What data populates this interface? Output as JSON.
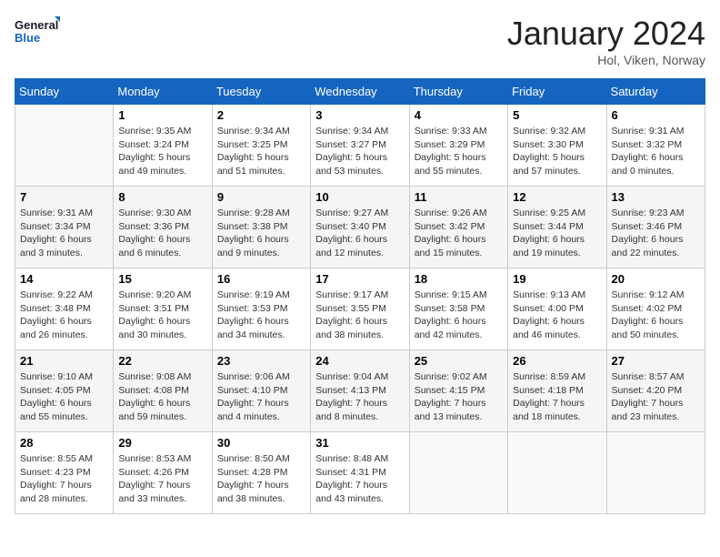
{
  "logo": {
    "line1": "General",
    "line2": "Blue"
  },
  "title": "January 2024",
  "location": "Hol, Viken, Norway",
  "days_of_week": [
    "Sunday",
    "Monday",
    "Tuesday",
    "Wednesday",
    "Thursday",
    "Friday",
    "Saturday"
  ],
  "weeks": [
    [
      {
        "day": "",
        "info": ""
      },
      {
        "day": "1",
        "info": "Sunrise: 9:35 AM\nSunset: 3:24 PM\nDaylight: 5 hours\nand 49 minutes."
      },
      {
        "day": "2",
        "info": "Sunrise: 9:34 AM\nSunset: 3:25 PM\nDaylight: 5 hours\nand 51 minutes."
      },
      {
        "day": "3",
        "info": "Sunrise: 9:34 AM\nSunset: 3:27 PM\nDaylight: 5 hours\nand 53 minutes."
      },
      {
        "day": "4",
        "info": "Sunrise: 9:33 AM\nSunset: 3:29 PM\nDaylight: 5 hours\nand 55 minutes."
      },
      {
        "day": "5",
        "info": "Sunrise: 9:32 AM\nSunset: 3:30 PM\nDaylight: 5 hours\nand 57 minutes."
      },
      {
        "day": "6",
        "info": "Sunrise: 9:31 AM\nSunset: 3:32 PM\nDaylight: 6 hours\nand 0 minutes."
      }
    ],
    [
      {
        "day": "7",
        "info": "Sunrise: 9:31 AM\nSunset: 3:34 PM\nDaylight: 6 hours\nand 3 minutes."
      },
      {
        "day": "8",
        "info": "Sunrise: 9:30 AM\nSunset: 3:36 PM\nDaylight: 6 hours\nand 6 minutes."
      },
      {
        "day": "9",
        "info": "Sunrise: 9:28 AM\nSunset: 3:38 PM\nDaylight: 6 hours\nand 9 minutes."
      },
      {
        "day": "10",
        "info": "Sunrise: 9:27 AM\nSunset: 3:40 PM\nDaylight: 6 hours\nand 12 minutes."
      },
      {
        "day": "11",
        "info": "Sunrise: 9:26 AM\nSunset: 3:42 PM\nDaylight: 6 hours\nand 15 minutes."
      },
      {
        "day": "12",
        "info": "Sunrise: 9:25 AM\nSunset: 3:44 PM\nDaylight: 6 hours\nand 19 minutes."
      },
      {
        "day": "13",
        "info": "Sunrise: 9:23 AM\nSunset: 3:46 PM\nDaylight: 6 hours\nand 22 minutes."
      }
    ],
    [
      {
        "day": "14",
        "info": "Sunrise: 9:22 AM\nSunset: 3:48 PM\nDaylight: 6 hours\nand 26 minutes."
      },
      {
        "day": "15",
        "info": "Sunrise: 9:20 AM\nSunset: 3:51 PM\nDaylight: 6 hours\nand 30 minutes."
      },
      {
        "day": "16",
        "info": "Sunrise: 9:19 AM\nSunset: 3:53 PM\nDaylight: 6 hours\nand 34 minutes."
      },
      {
        "day": "17",
        "info": "Sunrise: 9:17 AM\nSunset: 3:55 PM\nDaylight: 6 hours\nand 38 minutes."
      },
      {
        "day": "18",
        "info": "Sunrise: 9:15 AM\nSunset: 3:58 PM\nDaylight: 6 hours\nand 42 minutes."
      },
      {
        "day": "19",
        "info": "Sunrise: 9:13 AM\nSunset: 4:00 PM\nDaylight: 6 hours\nand 46 minutes."
      },
      {
        "day": "20",
        "info": "Sunrise: 9:12 AM\nSunset: 4:02 PM\nDaylight: 6 hours\nand 50 minutes."
      }
    ],
    [
      {
        "day": "21",
        "info": "Sunrise: 9:10 AM\nSunset: 4:05 PM\nDaylight: 6 hours\nand 55 minutes."
      },
      {
        "day": "22",
        "info": "Sunrise: 9:08 AM\nSunset: 4:08 PM\nDaylight: 6 hours\nand 59 minutes."
      },
      {
        "day": "23",
        "info": "Sunrise: 9:06 AM\nSunset: 4:10 PM\nDaylight: 7 hours\nand 4 minutes."
      },
      {
        "day": "24",
        "info": "Sunrise: 9:04 AM\nSunset: 4:13 PM\nDaylight: 7 hours\nand 8 minutes."
      },
      {
        "day": "25",
        "info": "Sunrise: 9:02 AM\nSunset: 4:15 PM\nDaylight: 7 hours\nand 13 minutes."
      },
      {
        "day": "26",
        "info": "Sunrise: 8:59 AM\nSunset: 4:18 PM\nDaylight: 7 hours\nand 18 minutes."
      },
      {
        "day": "27",
        "info": "Sunrise: 8:57 AM\nSunset: 4:20 PM\nDaylight: 7 hours\nand 23 minutes."
      }
    ],
    [
      {
        "day": "28",
        "info": "Sunrise: 8:55 AM\nSunset: 4:23 PM\nDaylight: 7 hours\nand 28 minutes."
      },
      {
        "day": "29",
        "info": "Sunrise: 8:53 AM\nSunset: 4:26 PM\nDaylight: 7 hours\nand 33 minutes."
      },
      {
        "day": "30",
        "info": "Sunrise: 8:50 AM\nSunset: 4:28 PM\nDaylight: 7 hours\nand 38 minutes."
      },
      {
        "day": "31",
        "info": "Sunrise: 8:48 AM\nSunset: 4:31 PM\nDaylight: 7 hours\nand 43 minutes."
      },
      {
        "day": "",
        "info": ""
      },
      {
        "day": "",
        "info": ""
      },
      {
        "day": "",
        "info": ""
      }
    ]
  ]
}
